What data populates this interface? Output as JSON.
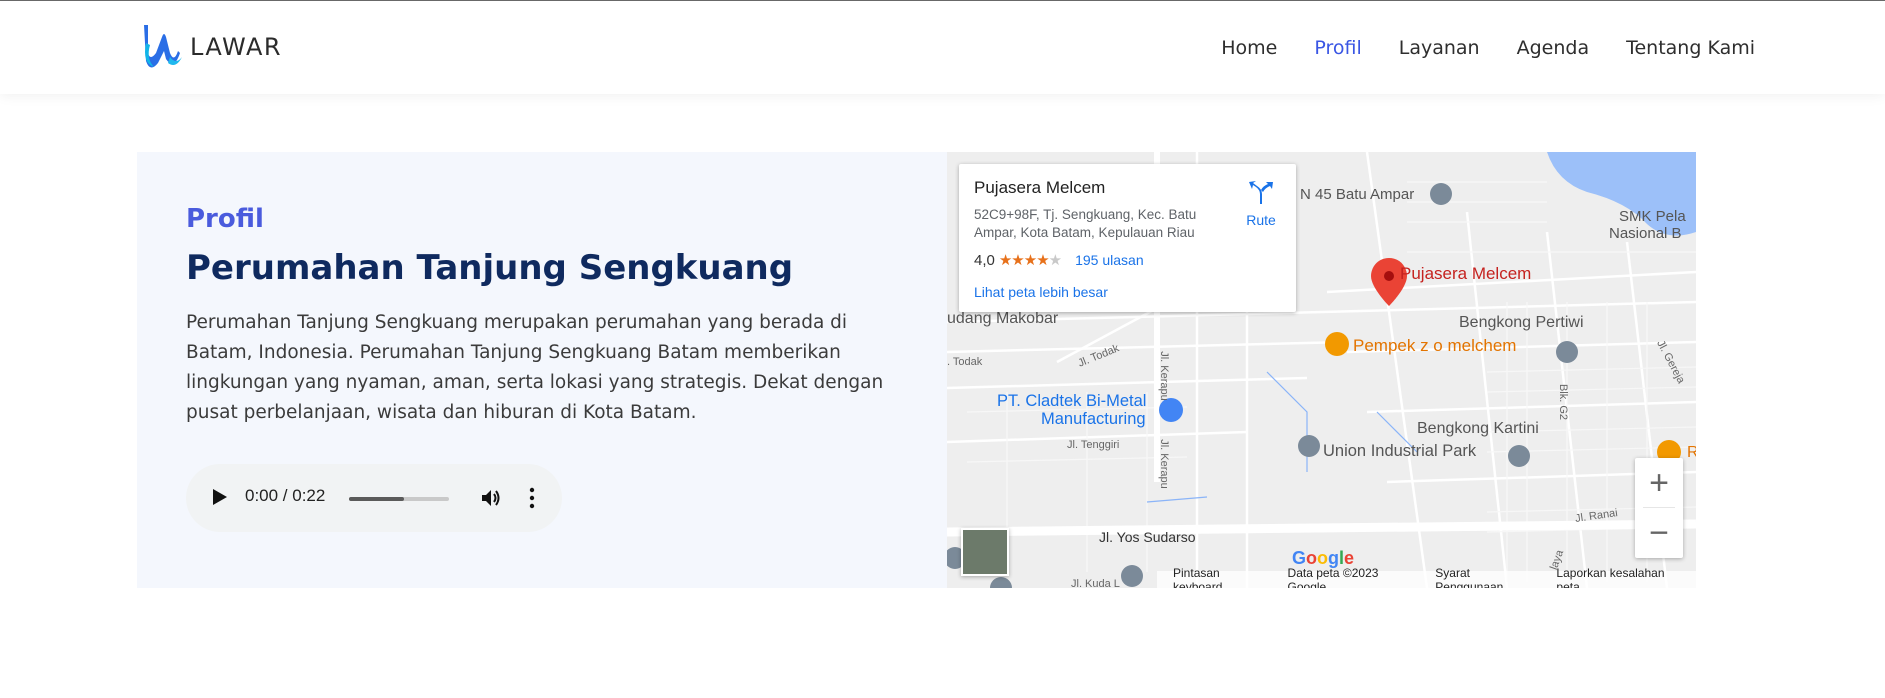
{
  "brand": {
    "name": "LAWAR"
  },
  "nav": {
    "items": [
      {
        "label": "Home",
        "active": false
      },
      {
        "label": "Profil",
        "active": true
      },
      {
        "label": "Layanan",
        "active": false
      },
      {
        "label": "Agenda",
        "active": false
      },
      {
        "label": "Tentang Kami",
        "active": false
      }
    ]
  },
  "profile": {
    "eyebrow": "Profil",
    "title": "Perumahan Tanjung Sengkuang",
    "description": "Perumahan Tanjung Sengkuang merupakan perumahan yang berada di Batam, Indonesia. Perumahan Tanjung Sengkuang Batam memberikan lingkungan yang nyaman, aman, serta lokasi yang strategis. Dekat dengan pusat perbelanjaan, wisata dan hiburan di Kota Batam."
  },
  "audio": {
    "time": "0:00 / 0:22",
    "progress_fraction": 0.55
  },
  "map": {
    "card": {
      "name": "Pujasera Melcem",
      "address": "52C9+98F, Tj. Sengkuang, Kec. Batu Ampar, Kota Batam, Kepulauan Riau",
      "rating": "4,0",
      "stars": 4,
      "reviews": "195 ulasan",
      "larger_map": "Lihat peta lebih besar",
      "route": "Rute"
    },
    "labels": {
      "pin": "Pujasera Melcem",
      "school": "N 45 Batu Ampar",
      "smk1": "SMK Pela",
      "smk2": "Nasional B",
      "gudang": "udang Makobar",
      "bengkong_pertiwi": "Bengkong Pertiwi",
      "pempek": "Pempek z o melchem",
      "todak_rd": "Jl. Todak",
      "todak": ". Todak",
      "kerapu1": "Jl. Kerapu",
      "kerapu2": "Jl. Kerapu",
      "pt1": "PT. Cladtek Bi-Metal",
      "pt2": "Manufacturing",
      "tenggiri": "Jl. Tenggiri",
      "bengkong_kartini": "Bengkong Kartini",
      "union": "Union Industrial Park",
      "blk": "Blk. G2",
      "gereja": "Jl. Gereja",
      "ranai": "Jl. Ranai",
      "yos": "Jl. Yos Sudarso",
      "kuda": "Jl. Kuda L",
      "r": "R",
      "laya": "laya"
    },
    "google_logo": "Google",
    "footer": {
      "shortcuts": "Pintasan keyboard",
      "data": "Data peta ©2023 Google",
      "terms": "Syarat Penggunaan",
      "report": "Laporkan kesalahan peta"
    },
    "zoom_in": "+",
    "zoom_out": "−"
  }
}
